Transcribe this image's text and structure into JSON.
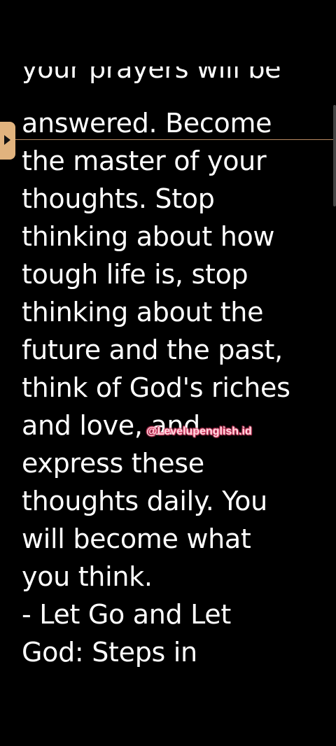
{
  "reader": {
    "lines": [
      "your prayers will be",
      "answered. Become",
      "the master of your",
      "thoughts. Stop",
      "thinking about how",
      "tough life is, stop",
      "thinking about the",
      "future and the past,",
      "think of God's riches",
      "and love, and",
      "express these",
      "thoughts daily. You",
      "will become what",
      "you think.",
      "- Let Go and Let",
      "God: Steps in"
    ]
  },
  "watermark": {
    "text": "@Levelupenglish.id"
  },
  "colors": {
    "background": "#000000",
    "text": "#ffffff",
    "tab": "#e1b37e",
    "watermark_glow": "#e74d77"
  },
  "icons": {
    "page_tab": "play-triangle-icon"
  }
}
